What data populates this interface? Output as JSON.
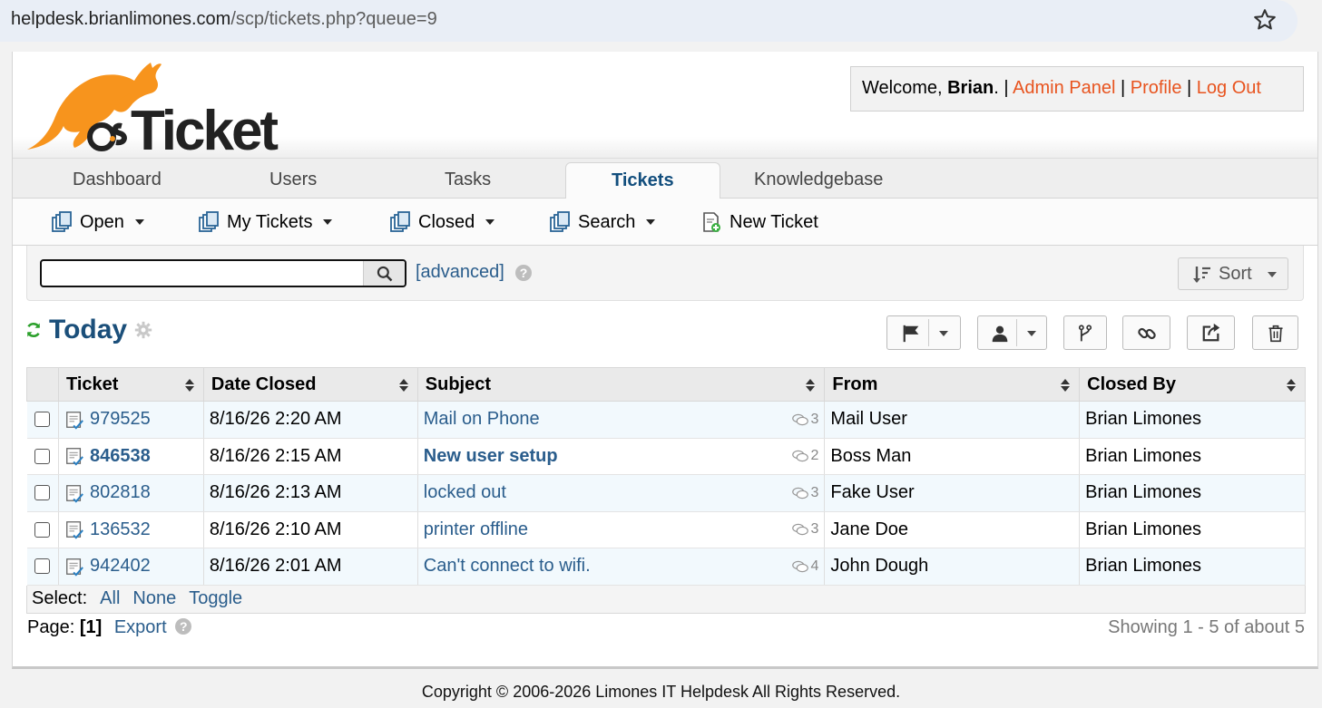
{
  "browser": {
    "url_host": "helpdesk.brianlimones.com",
    "url_path": "/scp/tickets.php?queue=9"
  },
  "header": {
    "welcome_prefix": "Welcome,",
    "user_name": "Brian",
    "welcome_suffix": ".",
    "sep": "|",
    "admin_panel": "Admin Panel",
    "profile": "Profile",
    "logout": "Log Out",
    "logo_text": "osTicket"
  },
  "nav": {
    "tabs": [
      {
        "label": "Dashboard"
      },
      {
        "label": "Users"
      },
      {
        "label": "Tasks"
      },
      {
        "label": "Tickets"
      },
      {
        "label": "Knowledgebase"
      }
    ],
    "active": "Tickets"
  },
  "subnav": {
    "items": [
      {
        "label": "Open"
      },
      {
        "label": "My Tickets"
      },
      {
        "label": "Closed"
      },
      {
        "label": "Search"
      },
      {
        "label": "New Ticket"
      }
    ]
  },
  "search": {
    "value": "",
    "advanced_label": "[advanced]",
    "sort_label": "Sort"
  },
  "queue": {
    "title": "Today"
  },
  "table": {
    "headers": [
      "Ticket",
      "Date Closed",
      "Subject",
      "From",
      "Closed By"
    ],
    "rows": [
      {
        "ticket": "979525",
        "date": "8/16/26 2:20 AM",
        "subject": "Mail on Phone",
        "threads": "3",
        "from": "Mail User",
        "closed_by": "Brian Limones",
        "bold": false
      },
      {
        "ticket": "846538",
        "date": "8/16/26 2:15 AM",
        "subject": "New user setup",
        "threads": "2",
        "from": "Boss Man",
        "closed_by": "Brian Limones",
        "bold": true
      },
      {
        "ticket": "802818",
        "date": "8/16/26 2:13 AM",
        "subject": "locked out",
        "threads": "3",
        "from": "Fake User",
        "closed_by": "Brian Limones",
        "bold": false
      },
      {
        "ticket": "136532",
        "date": "8/16/26 2:10 AM",
        "subject": "printer offline",
        "threads": "3",
        "from": "Jane Doe",
        "closed_by": "Brian Limones",
        "bold": false
      },
      {
        "ticket": "942402",
        "date": "8/16/26 2:01 AM",
        "subject": "Can't connect to wifi.",
        "threads": "4",
        "from": "John Dough",
        "closed_by": "Brian Limones",
        "bold": false
      }
    ]
  },
  "select": {
    "label": "Select:",
    "all": "All",
    "none": "None",
    "toggle": "Toggle"
  },
  "pager": {
    "page_label": "Page:",
    "current": "[1]",
    "export": "Export",
    "showing": "Showing 1 - 5 of about 5"
  },
  "footer": {
    "copyright": "Copyright © 2006-2026 Limones IT Helpdesk All Rights Reserved."
  },
  "colors": {
    "link": "#2a5d8c",
    "accent_orange": "#e8541f",
    "logo_orange": "#f7941d",
    "refresh_green": "#2ca02c"
  },
  "icons": {
    "star": "star-icon",
    "queue": "queue-icon",
    "search": "search-icon",
    "help": "help-icon",
    "sort": "sort-icon",
    "refresh": "refresh-icon",
    "gear": "gear-icon",
    "flag": "flag-icon",
    "user": "user-icon",
    "merge": "merge-icon",
    "link": "link-icon",
    "share": "share-icon",
    "trash": "trash-icon",
    "ticket": "ticket-icon",
    "thread": "thread-count-icon"
  }
}
